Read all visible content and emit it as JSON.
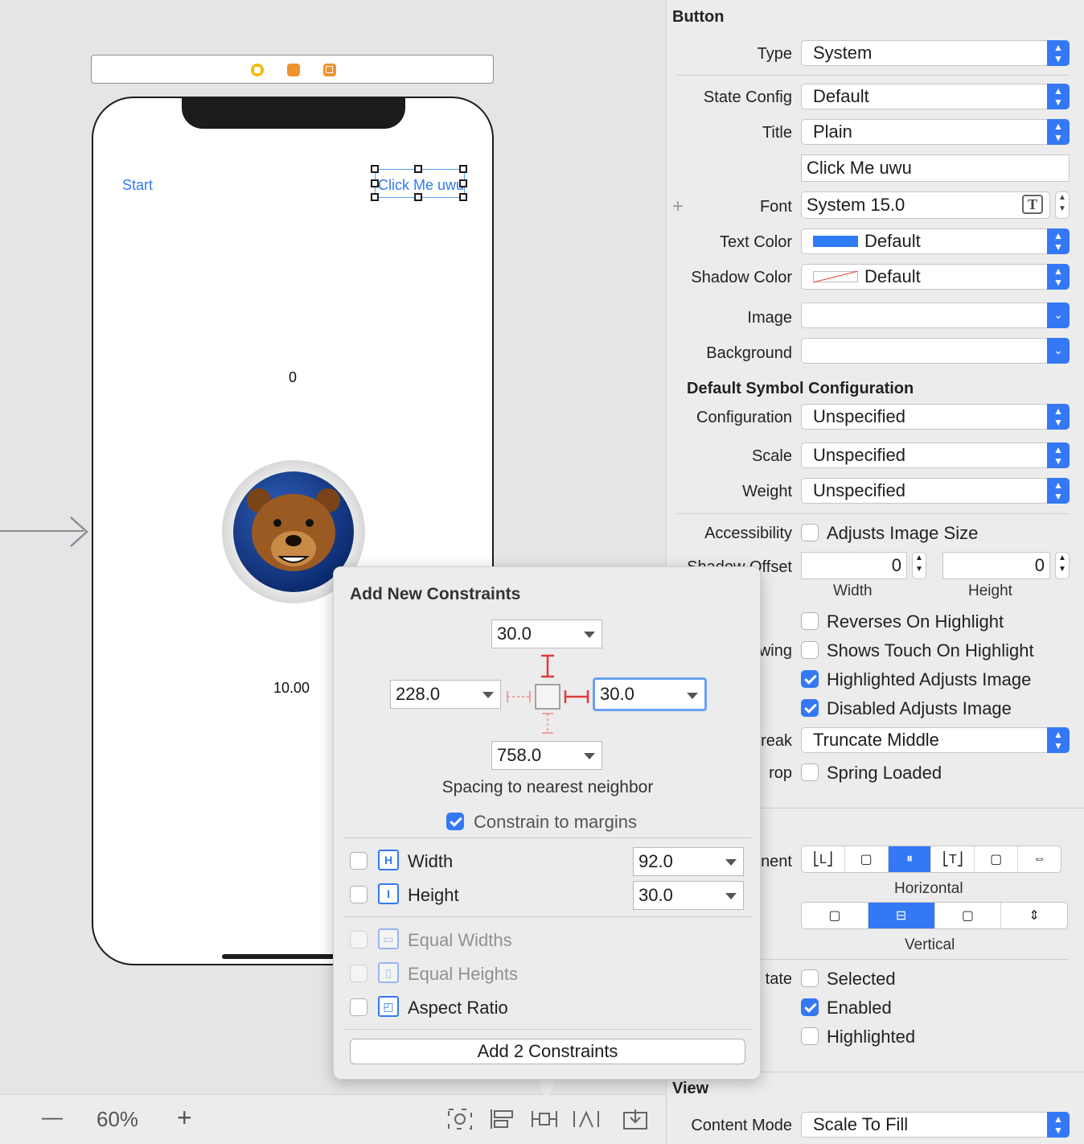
{
  "canvas": {
    "phone": {
      "start_button": "Start",
      "selected_button": "Click Me uwu",
      "counter_label": "0",
      "amount_label": "10.00"
    }
  },
  "bottom_bar": {
    "zoom_out": "—",
    "zoom_level": "60%",
    "zoom_in": "+"
  },
  "constraints_popover": {
    "title": "Add New Constraints",
    "top_value": "30.0",
    "leading_value": "228.0",
    "trailing_value": "30.0",
    "bottom_value": "758.0",
    "spacing_caption": "Spacing to nearest neighbor",
    "constrain_margins_label": "Constrain to margins",
    "constrain_margins_checked": true,
    "width_label": "Width",
    "width_value": "92.0",
    "height_label": "Height",
    "height_value": "30.0",
    "equal_widths_label": "Equal Widths",
    "equal_heights_label": "Equal Heights",
    "aspect_ratio_label": "Aspect Ratio",
    "add_button": "Add 2 Constraints"
  },
  "inspector": {
    "section_button": "Button",
    "type_label": "Type",
    "type_value": "System",
    "state_config_label": "State Config",
    "state_config_value": "Default",
    "title_label": "Title",
    "title_style_value": "Plain",
    "title_text_value": "Click Me uwu",
    "font_label": "Font",
    "font_value": "System 15.0",
    "text_color_label": "Text Color",
    "text_color_value": "Default",
    "text_color_swatch": "#2f7bf5",
    "shadow_color_label": "Shadow Color",
    "shadow_color_value": "Default",
    "image_label": "Image",
    "background_label": "Background",
    "symbol_section": "Default Symbol Configuration",
    "configuration_label": "Configuration",
    "configuration_value": "Unspecified",
    "scale_label": "Scale",
    "scale_value": "Unspecified",
    "weight_label": "Weight",
    "weight_value": "Unspecified",
    "accessibility_label": "Accessibility",
    "adjusts_image_size": "Adjusts Image Size",
    "shadow_offset_label": "Shadow Offset",
    "shadow_width_value": "0",
    "shadow_height_value": "0",
    "width_caption": "Width",
    "height_caption": "Height",
    "drawing_label_partial": "wing",
    "reverses_on_highlight": "Reverses On Highlight",
    "shows_touch_on_highlight": "Shows Touch On Highlight",
    "highlighted_adjusts_image": "Highlighted Adjusts Image",
    "disabled_adjusts_image": "Disabled Adjusts Image",
    "line_break_label_partial": "reak",
    "line_break_value": "Truncate Middle",
    "drag_drop_label_partial": "rop",
    "spring_loaded": "Spring Loaded",
    "alignment_label_partial": "nent",
    "horizontal_caption": "Horizontal",
    "vertical_caption": "Vertical",
    "state_label_partial": "tate",
    "selected": "Selected",
    "enabled": "Enabled",
    "highlighted": "Highlighted",
    "view_section": "View",
    "content_mode_label": "Content Mode",
    "content_mode_value": "Scale To Fill"
  }
}
